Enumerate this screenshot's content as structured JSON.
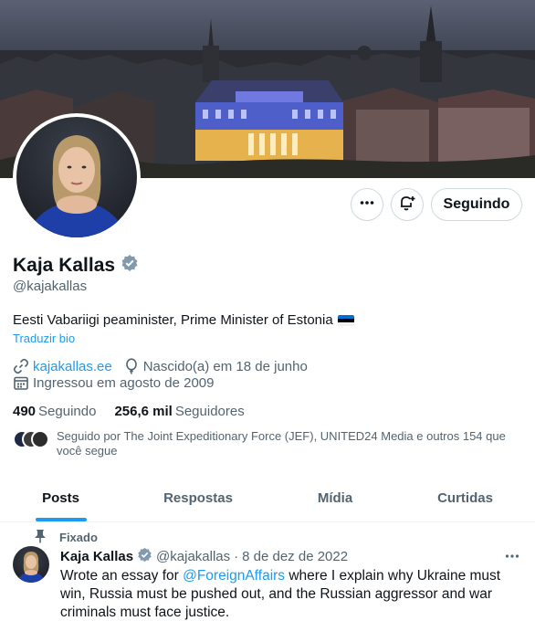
{
  "profile": {
    "display_name": "Kaja Kallas",
    "handle": "@kajakallas",
    "bio": "Eesti Vabariigi peaminister, Prime Minister of Estonia",
    "translate_label": "Traduzir bio",
    "website": "kajakallas.ee",
    "birthday": "Nascido(a) em 18 de junho",
    "joined": "Ingressou em agosto de 2009",
    "following_count": "490",
    "following_label": "Seguindo",
    "followers_count": "256,6 mil",
    "followers_label": "Seguidores",
    "followed_by": "Seguido por The Joint Expeditionary Force (JEF), UNITED24 Media e outros 154 que você segue",
    "verified_color": "#829aab",
    "flag_colors": [
      "#0072ce",
      "#000000",
      "#ffffff"
    ]
  },
  "actions": {
    "following_button": "Seguindo",
    "more_icon": "ellipsis-icon",
    "notify_icon": "bell-plus-icon"
  },
  "tabs": [
    {
      "label": "Posts",
      "active": true
    },
    {
      "label": "Respostas",
      "active": false
    },
    {
      "label": "Mídia",
      "active": false
    },
    {
      "label": "Curtidas",
      "active": false
    }
  ],
  "pinned_tweet": {
    "pinned_label": "Fixado",
    "author_name": "Kaja Kallas",
    "author_handle": "@kajakallas",
    "separator": "·",
    "date": "8 de dez de 2022",
    "text_before": "Wrote an essay for ",
    "mention": "@ForeignAffairs",
    "text_after": " where I explain why Ukraine must win, Russia must be pushed out, and the Russian aggressor and war criminals must face justice."
  },
  "colors": {
    "accent": "#1d9bf0",
    "secondary_text": "#536471",
    "primary_text": "#0f1419",
    "border": "#cfd9de"
  }
}
